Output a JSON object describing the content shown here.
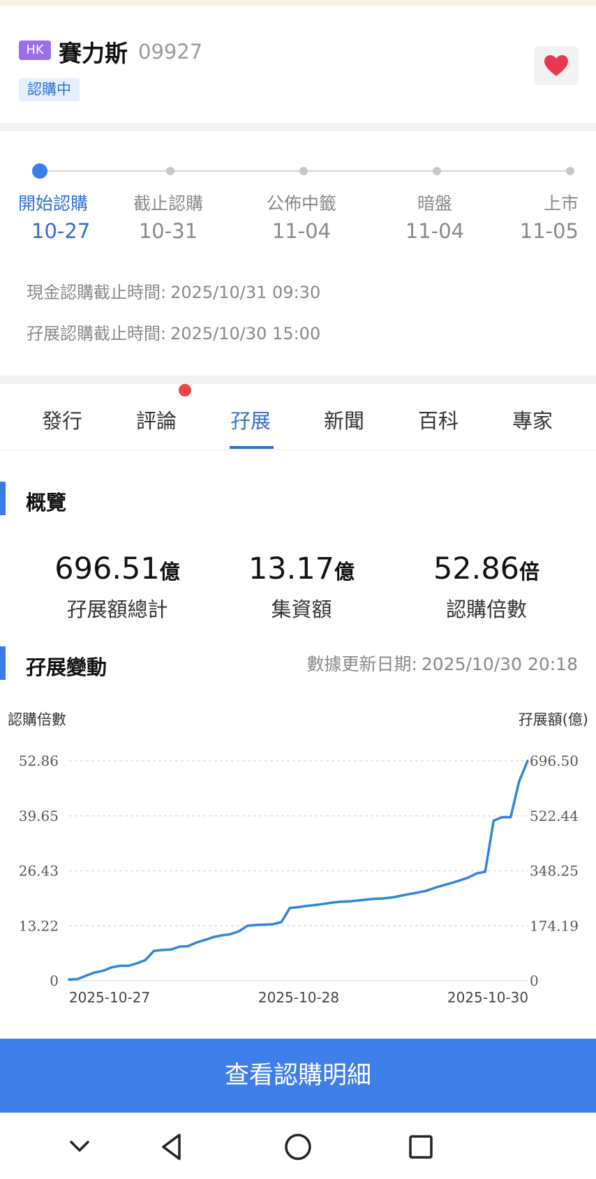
{
  "header": {
    "market": "HK",
    "name": "賽力斯",
    "code": "09927",
    "status": "認購中"
  },
  "timeline": {
    "steps": [
      {
        "label": "開始認購",
        "date": "10-27",
        "active": true
      },
      {
        "label": "截止認購",
        "date": "10-31",
        "active": false
      },
      {
        "label": "公佈中籤",
        "date": "11-04",
        "active": false
      },
      {
        "label": "暗盤",
        "date": "11-04",
        "active": false
      },
      {
        "label": "上市",
        "date": "11-05",
        "active": false
      }
    ],
    "cash_deadline_label": "現金認購截止時間:",
    "cash_deadline_value": "2025/10/31 09:30",
    "margin_deadline_label": "孖展認購截止時間:",
    "margin_deadline_value": "2025/10/30 15:00"
  },
  "tabs": [
    "發行",
    "評論",
    "孖展",
    "新聞",
    "百科",
    "專家"
  ],
  "active_tab": "孖展",
  "overview": {
    "title": "概覽",
    "stats": [
      {
        "value": "696.51",
        "unit": "億",
        "label": "孖展額總計"
      },
      {
        "value": "13.17",
        "unit": "億",
        "label": "集資額"
      },
      {
        "value": "52.86",
        "unit": "倍",
        "label": "認購倍數"
      }
    ]
  },
  "margin_change": {
    "title": "孖展變動",
    "update_label": "數據更新日期:",
    "update_value": "2025/10/30 20:18",
    "left_axis_title": "認購倍數",
    "right_axis_title": "孖展額(億)"
  },
  "chart_data": {
    "type": "line",
    "x_ticks": [
      "2025-10-27",
      "2025-10-28",
      "2025-10-30"
    ],
    "left_ticks": [
      "0",
      "13.22",
      "26.43",
      "39.65",
      "52.86"
    ],
    "right_ticks": [
      "0",
      "174.19",
      "348.25",
      "522.44",
      "696.50"
    ],
    "ylim": [
      0,
      52.86
    ],
    "grid": true,
    "color": "#2f86d6",
    "series": [
      {
        "values": [
          0.3,
          0.4,
          1.2,
          2.0,
          2.4,
          3.2,
          3.6,
          3.6,
          4.2,
          5.0,
          7.2,
          7.4,
          7.5,
          8.2,
          8.3,
          9.2,
          9.8,
          10.5,
          10.9,
          11.2,
          11.9,
          13.2,
          13.4,
          13.5,
          13.6,
          14.1,
          17.5,
          17.7,
          18.0,
          18.2,
          18.5,
          18.8,
          19.0,
          19.1,
          19.3,
          19.5,
          19.7,
          19.8,
          20.0,
          20.4,
          20.8,
          21.2,
          21.6,
          22.3,
          22.9,
          23.5,
          24.1,
          24.8,
          25.8,
          26.2,
          38.5,
          39.3,
          39.3,
          47.9,
          52.86
        ]
      }
    ]
  },
  "cta_label": "查看認購明細",
  "colors": {
    "accent": "#2f6fcf",
    "cta": "#3e7ee9",
    "badge_market": "#9b6ee8",
    "heart": "#e8374f"
  }
}
